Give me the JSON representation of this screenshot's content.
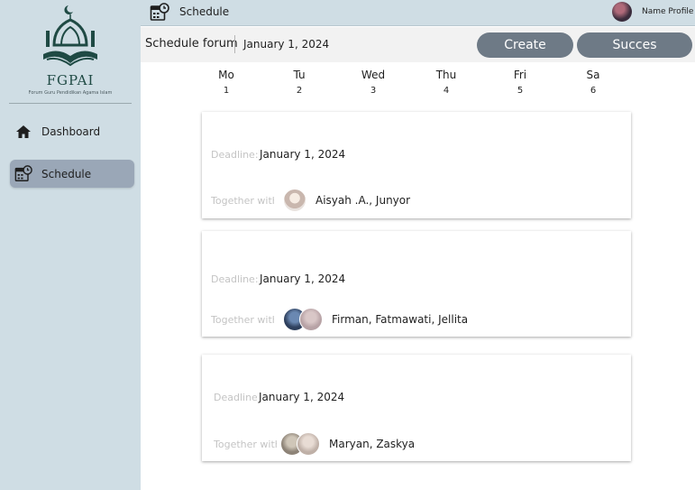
{
  "brand": {
    "name": "FGPAI",
    "subtitle": "Forum Guru Pendidikan Agama Islam"
  },
  "sidebar": {
    "items": [
      {
        "label": "Dashboard",
        "icon": "home-icon",
        "active": false
      },
      {
        "label": "Schedule",
        "icon": "calendar-clock-icon",
        "active": true
      }
    ]
  },
  "topbar": {
    "title": "Schedule",
    "profile_name": "Name Profile"
  },
  "header": {
    "title": "Schedule forum",
    "date": "January 1, 2024",
    "create_label": "Create",
    "succes_label": "Succes"
  },
  "week": [
    {
      "name": "Mo",
      "num": "1"
    },
    {
      "name": "Tu",
      "num": "2"
    },
    {
      "name": "Wed",
      "num": "3"
    },
    {
      "name": "Thu",
      "num": "4"
    },
    {
      "name": "Fri",
      "num": "5"
    },
    {
      "name": "Sa",
      "num": "6"
    }
  ],
  "cards": [
    {
      "deadline_label": "Deadline:",
      "deadline": "January 1, 2024",
      "with_label": "Together with:",
      "members": "Aisyah .A., Junyor"
    },
    {
      "deadline_label": "Deadline:",
      "deadline": "January 1, 2024",
      "with_label": "Together with:",
      "members": "Firman, Fatmawati, Jellita"
    },
    {
      "deadline_label": "Deadline:",
      "deadline": "January 1, 2024",
      "with_label": "Together with:",
      "members": "Maryan, Zaskya"
    }
  ],
  "colors": {
    "sidebar_bg": "#cfdde4",
    "active_nav": "#9aa7b7",
    "button": "#6e7a86",
    "logo_green": "#1f4a44"
  }
}
